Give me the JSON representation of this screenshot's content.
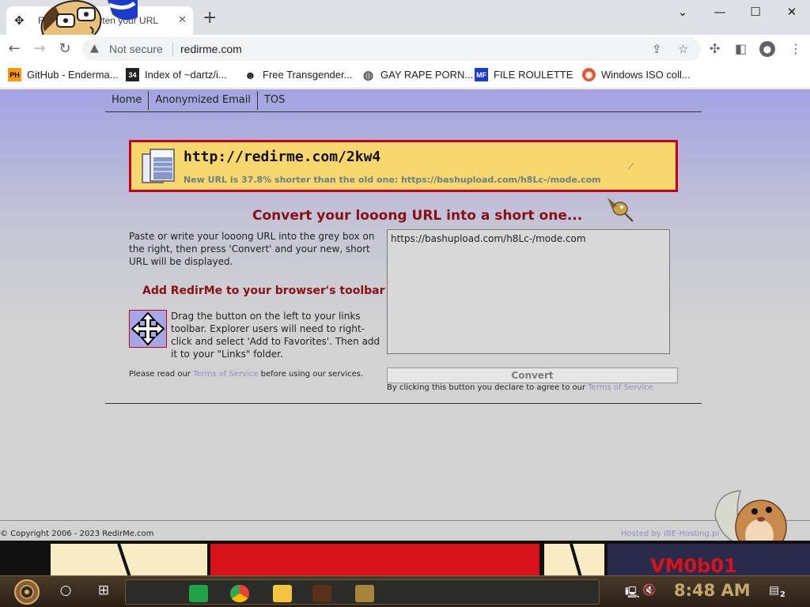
{
  "browser": {
    "tab_title": "RedirMe - Shorten your URL",
    "new_tab": "+",
    "window_controls": [
      "minimize",
      "maximize",
      "close"
    ],
    "security_label": "Not secure",
    "url": "redirme.com"
  },
  "bookmarks": [
    {
      "label": "GitHub - Enderma...",
      "icon": "PH",
      "icon_bg": "#ff9900",
      "icon_fg": "#000000"
    },
    {
      "label": "Index of ~dartz/i...",
      "icon": "34",
      "icon_bg": "#222222",
      "icon_fg": "#ffffff"
    },
    {
      "label": "Free Transgender...",
      "icon": "robot",
      "icon_bg": "#ffffff",
      "icon_fg": "#333333"
    },
    {
      "label": "GAY RAPE PORN...",
      "icon": "globe",
      "icon_bg": "#ffffff",
      "icon_fg": "#555555"
    },
    {
      "label": "FILE ROULETTE",
      "icon": "MF",
      "icon_bg": "#1a3cc8",
      "icon_fg": "#ffffff"
    },
    {
      "label": "Windows ISO coll...",
      "icon": "duck",
      "icon_bg": "#de5833",
      "icon_fg": "#ffffff"
    }
  ],
  "nav": [
    "Home",
    "Anonymized Email",
    "TOS"
  ],
  "result": {
    "short_url": "http://redirme.com/2kw4",
    "summary": "New URL is 37.8% shorter than the old one: https://bashupload.com/h8Lc-/mode.com"
  },
  "headline": "Convert your looong URL into a short one...",
  "description": "Paste or write your looong URL into the grey box on the right, then press 'Convert' and your new, short URL will be displayed.",
  "toolbar_heading": "Add RedirMe to your browser's toolbar",
  "drag_description": "Drag the button on the left to your links toolbar. Explorer users will need to right-click and select 'Add to Favorites'. Then add it to your \"Links\" folder.",
  "tos_note": {
    "before": "Please read our ",
    "link": "Terms of Service",
    "after": " before using our services."
  },
  "input_value": "https://bashupload.com/h8Lc-/mode.com",
  "convert_label": "Convert",
  "agree_note": {
    "before": "By clicking this button you declare to agree to our ",
    "link": "Terms of Service"
  },
  "footer": {
    "copyright_prefix": "© Copyright 2006 - 2023 ",
    "copyright_brand": "RedirMe.com",
    "hosted": "Hosted by IBE-Hosting.pl"
  },
  "taskbar": {
    "clock": "8:48 AM",
    "notification_count": "2",
    "wallpaper_text": "VM0b01"
  },
  "colors": {
    "accent_red": "#8a0f15",
    "result_bg": "#f7d76e",
    "page_bg_top": "#a3a3e2",
    "link_lavender": "#8e8ec8"
  }
}
